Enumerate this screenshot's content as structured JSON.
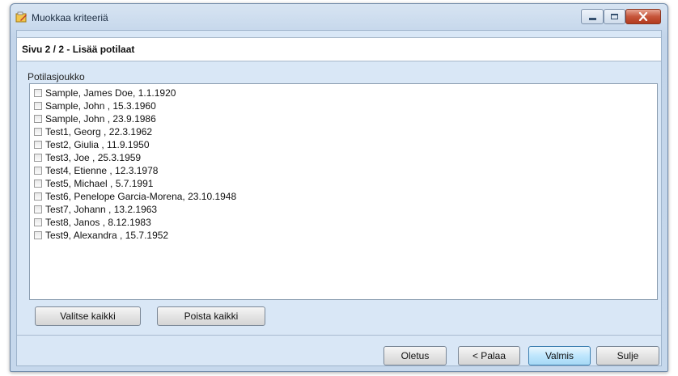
{
  "window": {
    "title": "Muokkaa kriteeriä"
  },
  "header": {
    "title": "Sivu 2 / 2 - Lisää potilaat"
  },
  "group": {
    "label": "Potilasjoukko"
  },
  "patients": [
    "Sample, James Doe, 1.1.1920",
    "Sample, John , 15.3.1960",
    "Sample, John , 23.9.1986",
    "Test1, Georg , 22.3.1962",
    "Test2, Giulia , 11.9.1950",
    "Test3, Joe , 25.3.1959",
    "Test4, Etienne , 12.3.1978",
    "Test5, Michael , 5.7.1991",
    "Test6, Penelope Garcia-Morena, 23.10.1948",
    "Test7, Johann , 13.2.1963",
    "Test8, Janos , 8.12.1983",
    "Test9, Alexandra , 15.7.1952"
  ],
  "selection": {
    "select_all": "Valitse kaikki",
    "clear_all": "Poista kaikki"
  },
  "footer": {
    "default": "Oletus",
    "back": "< Palaa",
    "finish": "Valmis",
    "close": "Sulje"
  }
}
